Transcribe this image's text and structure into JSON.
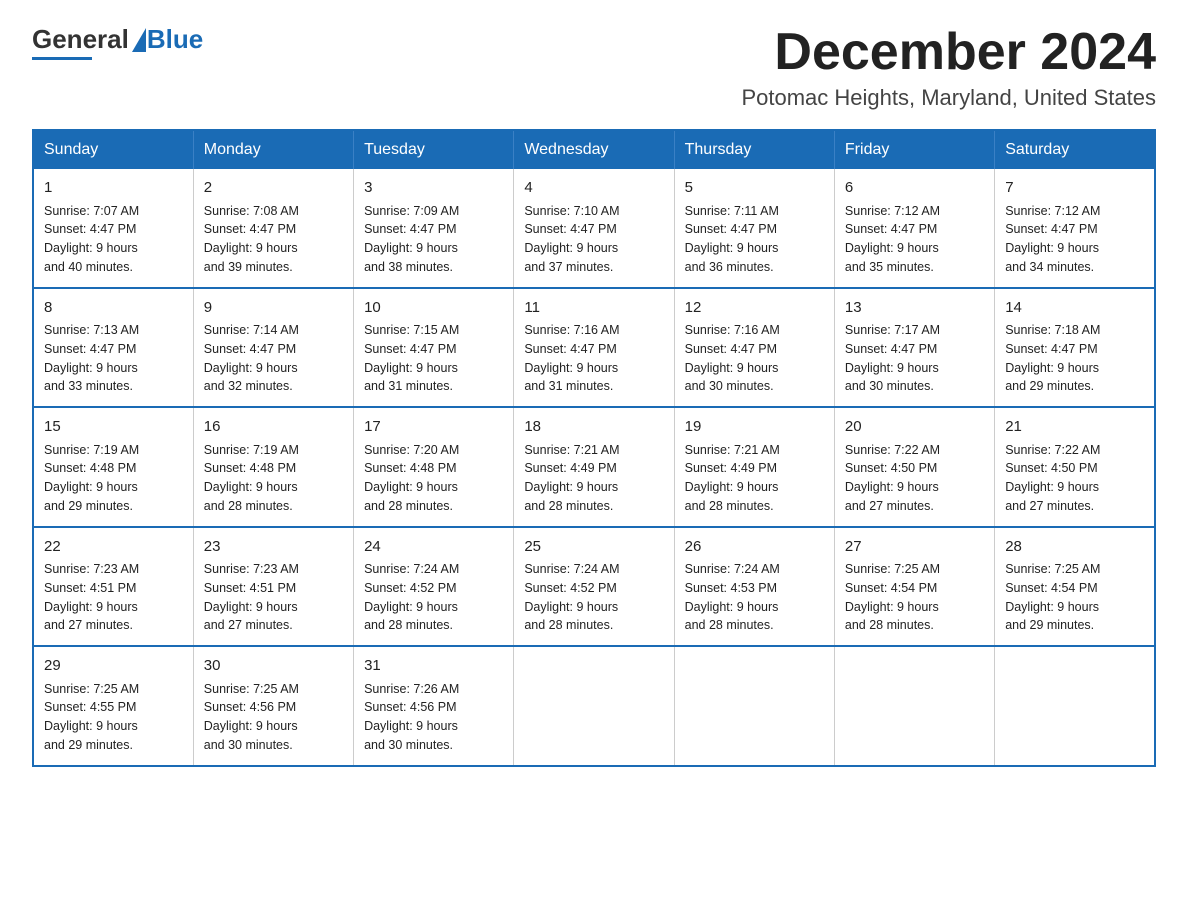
{
  "logo": {
    "general": "General",
    "blue": "Blue"
  },
  "title": {
    "month_year": "December 2024",
    "location": "Potomac Heights, Maryland, United States"
  },
  "days_of_week": [
    "Sunday",
    "Monday",
    "Tuesday",
    "Wednesday",
    "Thursday",
    "Friday",
    "Saturday"
  ],
  "weeks": [
    [
      {
        "day": "1",
        "sunrise": "7:07 AM",
        "sunset": "4:47 PM",
        "daylight": "9 hours and 40 minutes."
      },
      {
        "day": "2",
        "sunrise": "7:08 AM",
        "sunset": "4:47 PM",
        "daylight": "9 hours and 39 minutes."
      },
      {
        "day": "3",
        "sunrise": "7:09 AM",
        "sunset": "4:47 PM",
        "daylight": "9 hours and 38 minutes."
      },
      {
        "day": "4",
        "sunrise": "7:10 AM",
        "sunset": "4:47 PM",
        "daylight": "9 hours and 37 minutes."
      },
      {
        "day": "5",
        "sunrise": "7:11 AM",
        "sunset": "4:47 PM",
        "daylight": "9 hours and 36 minutes."
      },
      {
        "day": "6",
        "sunrise": "7:12 AM",
        "sunset": "4:47 PM",
        "daylight": "9 hours and 35 minutes."
      },
      {
        "day": "7",
        "sunrise": "7:12 AM",
        "sunset": "4:47 PM",
        "daylight": "9 hours and 34 minutes."
      }
    ],
    [
      {
        "day": "8",
        "sunrise": "7:13 AM",
        "sunset": "4:47 PM",
        "daylight": "9 hours and 33 minutes."
      },
      {
        "day": "9",
        "sunrise": "7:14 AM",
        "sunset": "4:47 PM",
        "daylight": "9 hours and 32 minutes."
      },
      {
        "day": "10",
        "sunrise": "7:15 AM",
        "sunset": "4:47 PM",
        "daylight": "9 hours and 31 minutes."
      },
      {
        "day": "11",
        "sunrise": "7:16 AM",
        "sunset": "4:47 PM",
        "daylight": "9 hours and 31 minutes."
      },
      {
        "day": "12",
        "sunrise": "7:16 AM",
        "sunset": "4:47 PM",
        "daylight": "9 hours and 30 minutes."
      },
      {
        "day": "13",
        "sunrise": "7:17 AM",
        "sunset": "4:47 PM",
        "daylight": "9 hours and 30 minutes."
      },
      {
        "day": "14",
        "sunrise": "7:18 AM",
        "sunset": "4:47 PM",
        "daylight": "9 hours and 29 minutes."
      }
    ],
    [
      {
        "day": "15",
        "sunrise": "7:19 AM",
        "sunset": "4:48 PM",
        "daylight": "9 hours and 29 minutes."
      },
      {
        "day": "16",
        "sunrise": "7:19 AM",
        "sunset": "4:48 PM",
        "daylight": "9 hours and 28 minutes."
      },
      {
        "day": "17",
        "sunrise": "7:20 AM",
        "sunset": "4:48 PM",
        "daylight": "9 hours and 28 minutes."
      },
      {
        "day": "18",
        "sunrise": "7:21 AM",
        "sunset": "4:49 PM",
        "daylight": "9 hours and 28 minutes."
      },
      {
        "day": "19",
        "sunrise": "7:21 AM",
        "sunset": "4:49 PM",
        "daylight": "9 hours and 28 minutes."
      },
      {
        "day": "20",
        "sunrise": "7:22 AM",
        "sunset": "4:50 PM",
        "daylight": "9 hours and 27 minutes."
      },
      {
        "day": "21",
        "sunrise": "7:22 AM",
        "sunset": "4:50 PM",
        "daylight": "9 hours and 27 minutes."
      }
    ],
    [
      {
        "day": "22",
        "sunrise": "7:23 AM",
        "sunset": "4:51 PM",
        "daylight": "9 hours and 27 minutes."
      },
      {
        "day": "23",
        "sunrise": "7:23 AM",
        "sunset": "4:51 PM",
        "daylight": "9 hours and 27 minutes."
      },
      {
        "day": "24",
        "sunrise": "7:24 AM",
        "sunset": "4:52 PM",
        "daylight": "9 hours and 28 minutes."
      },
      {
        "day": "25",
        "sunrise": "7:24 AM",
        "sunset": "4:52 PM",
        "daylight": "9 hours and 28 minutes."
      },
      {
        "day": "26",
        "sunrise": "7:24 AM",
        "sunset": "4:53 PM",
        "daylight": "9 hours and 28 minutes."
      },
      {
        "day": "27",
        "sunrise": "7:25 AM",
        "sunset": "4:54 PM",
        "daylight": "9 hours and 28 minutes."
      },
      {
        "day": "28",
        "sunrise": "7:25 AM",
        "sunset": "4:54 PM",
        "daylight": "9 hours and 29 minutes."
      }
    ],
    [
      {
        "day": "29",
        "sunrise": "7:25 AM",
        "sunset": "4:55 PM",
        "daylight": "9 hours and 29 minutes."
      },
      {
        "day": "30",
        "sunrise": "7:25 AM",
        "sunset": "4:56 PM",
        "daylight": "9 hours and 30 minutes."
      },
      {
        "day": "31",
        "sunrise": "7:26 AM",
        "sunset": "4:56 PM",
        "daylight": "9 hours and 30 minutes."
      },
      null,
      null,
      null,
      null
    ]
  ],
  "labels": {
    "sunrise": "Sunrise:",
    "sunset": "Sunset:",
    "daylight": "Daylight:"
  }
}
